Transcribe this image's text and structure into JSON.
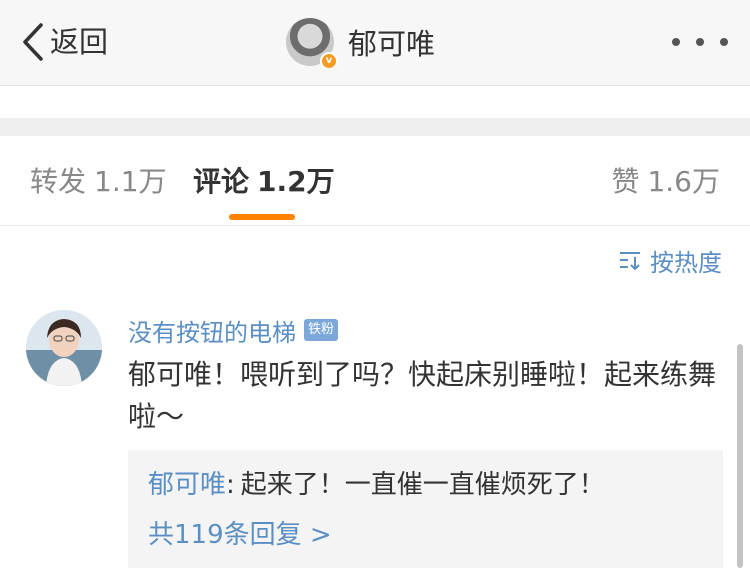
{
  "nav": {
    "back_label": "返回",
    "title": "郁可唯",
    "verified_icon": "v-badge-icon",
    "more_icon": "more-dots-icon"
  },
  "tabs": [
    {
      "label": "转发",
      "count": "1.1万",
      "active": false
    },
    {
      "label": "评论",
      "count": "1.2万",
      "active": true
    },
    {
      "label": "赞",
      "count": "1.6万",
      "active": false
    }
  ],
  "sort": {
    "label": "按热度",
    "icon": "sort-icon"
  },
  "comment": {
    "username": "没有按钮的电梯",
    "badge": "铁粉",
    "text": "郁可唯！喂听到了吗？快起床别睡啦！起来练舞啦～",
    "replies": {
      "author": "郁可唯",
      "separator": ":",
      "content": "起来了！一直催一直催烦死了！",
      "more_label": "共119条回复 >"
    }
  },
  "colors": {
    "accent": "#ff8200",
    "link": "#5b8fc4",
    "badge": "#7aa8d8",
    "verified": "#f59b22"
  }
}
